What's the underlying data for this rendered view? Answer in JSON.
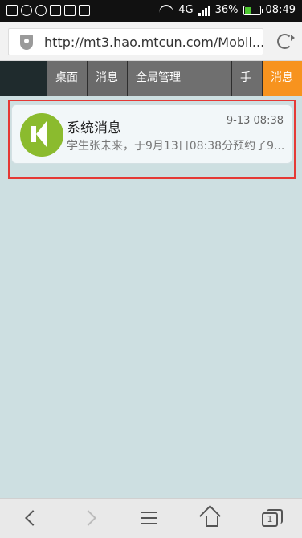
{
  "status": {
    "battery": "36%",
    "time": "08:49",
    "network": "4G"
  },
  "address": {
    "url": "http://mt3.hao.mtcun.com/Mobil..."
  },
  "nav": {
    "tabs": [
      "桌面",
      "消息",
      "全局管理",
      "手",
      "消息"
    ]
  },
  "message": {
    "title": "系统消息",
    "time": "9-13 08:38",
    "preview": "学生张未来，于9月13日08:38分预约了9..."
  },
  "bottom": {
    "tabs_count": "1"
  }
}
